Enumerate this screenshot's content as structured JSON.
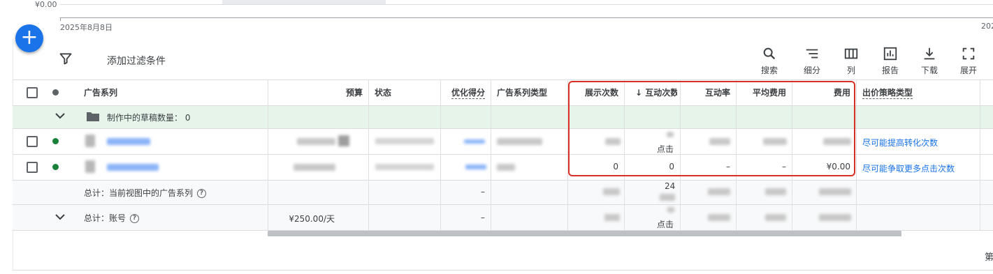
{
  "chart": {
    "y_label": "¥0.00",
    "x_start": "2025年8月8日",
    "x_end": "202"
  },
  "fab": {
    "label": "+"
  },
  "toolbar": {
    "filter_label": "添加过滤条件",
    "tools": [
      {
        "label": "搜索",
        "icon": "search-icon"
      },
      {
        "label": "细分",
        "icon": "segment-icon"
      },
      {
        "label": "列",
        "icon": "columns-icon"
      },
      {
        "label": "报告",
        "icon": "reports-icon"
      },
      {
        "label": "下载",
        "icon": "download-icon"
      },
      {
        "label": "展开",
        "icon": "expand-icon"
      }
    ]
  },
  "table": {
    "headers": {
      "campaign": "广告系列",
      "budget": "预算",
      "status": "状态",
      "opt_score": "优化得分",
      "campaign_type": "广告系列类型",
      "impressions": "展示次数",
      "interactions": "互动次数",
      "interaction_rate": "互动率",
      "avg_cost": "平均费用",
      "cost": "费用",
      "bid_strategy": "出价策略类型"
    },
    "draft_row": {
      "label": "制作中的草稿数量： 0"
    },
    "rows": [
      {
        "status_color": "#188038",
        "interactions_sub": "点击",
        "bid_strategy": "尽可能提高转化次数"
      },
      {
        "status_color": "#188038",
        "impressions": "0",
        "interactions": "0",
        "interaction_rate": "–",
        "avg_cost": "–",
        "cost": "¥0.00",
        "bid_strategy": "尽可能争取更多点击次数"
      }
    ],
    "total_view": {
      "label": "总计：当前视图中的广告系列",
      "opt_score": "–",
      "interactions": "24"
    },
    "total_account": {
      "label": "总计：账号",
      "budget": "¥250.00/天",
      "opt_score": "–",
      "interactions_sub": "点击"
    }
  },
  "pagination": {
    "label": "第"
  },
  "colors": {
    "accent": "#1a73e8",
    "highlight_box": "#d93025",
    "draft_row_bg": "#e6f4ea",
    "status_enabled": "#188038"
  }
}
